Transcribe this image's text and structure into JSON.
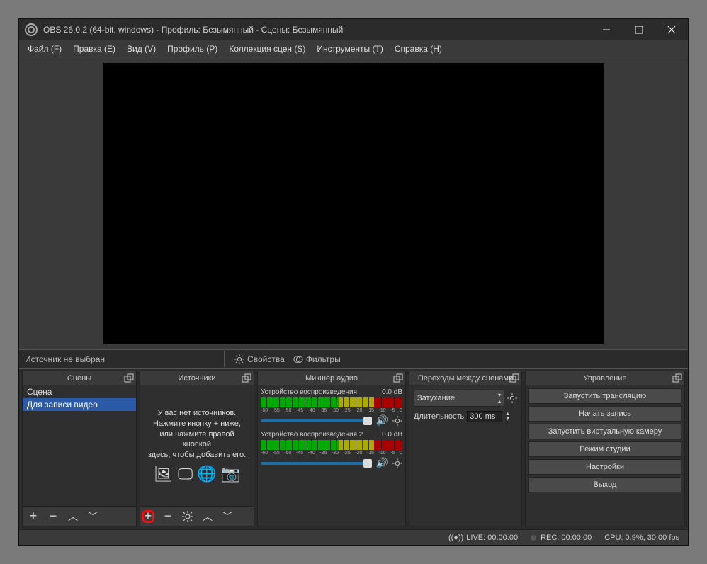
{
  "title": "OBS 26.0.2 (64-bit, windows) - Профиль: Безымянный - Сцены: Безымянный",
  "menu": {
    "file": "Файл (F)",
    "edit": "Правка (E)",
    "view": "Вид (V)",
    "profile": "Профиль (P)",
    "scene_collection": "Коллекция сцен (S)",
    "tools": "Инструменты (T)",
    "help": "Справка (H)"
  },
  "toolbar": {
    "no_source": "Источник не выбран",
    "props": "Свойства",
    "filters": "Фильтры"
  },
  "scenes": {
    "title": "Сцены",
    "items": [
      "Сцена",
      "Для записи видео"
    ],
    "selected": 1
  },
  "sources": {
    "title": "Источники",
    "hint1": "У вас нет источников.",
    "hint2": "Нажмите кнопку + ниже,",
    "hint3": "или нажмите правой кнопкой",
    "hint4": "здесь, чтобы добавить его."
  },
  "mixer": {
    "title": "Микшер аудио",
    "tracks": [
      {
        "name": "Устройство воспроизведения",
        "db": "0.0 dB",
        "ticks": [
          "-60",
          "-55",
          "-50",
          "-45",
          "-40",
          "-35",
          "-30",
          "-25",
          "-20",
          "-15",
          "-10",
          "-5",
          "0"
        ]
      },
      {
        "name": "Устройство воспроизведения 2",
        "db": "0.0 dB",
        "ticks": [
          "-60",
          "-55",
          "-50",
          "-45",
          "-40",
          "-35",
          "-30",
          "-25",
          "-20",
          "-15",
          "-10",
          "-5",
          "0"
        ]
      }
    ]
  },
  "transitions": {
    "title": "Переходы между сценами",
    "selected": "Затухание",
    "duration_label": "Длительность",
    "duration_value": "300 ms"
  },
  "controls": {
    "title": "Управление",
    "buttons": [
      "Запустить трансляцию",
      "Начать запись",
      "Запустить виртуальную камеру",
      "Режим студии",
      "Настройки",
      "Выход"
    ]
  },
  "status": {
    "live": "LIVE: 00:00:00",
    "rec": "REC: 00:00:00",
    "cpu": "CPU: 0.9%, 30.00 fps"
  }
}
